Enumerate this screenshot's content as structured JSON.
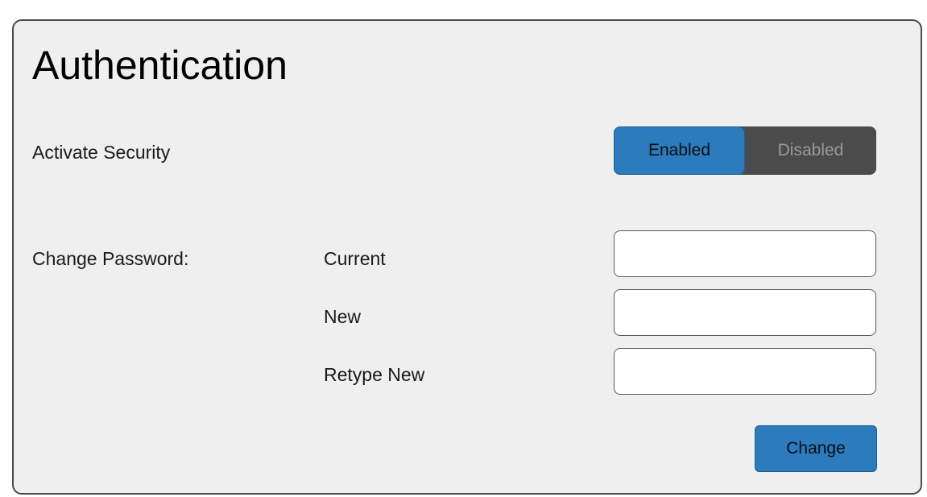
{
  "section": {
    "title": "Authentication"
  },
  "security": {
    "label": "Activate Security",
    "enabled_label": "Enabled",
    "disabled_label": "Disabled",
    "selected": "Enabled",
    "accent_color": "#2b7bbd"
  },
  "password": {
    "label": "Change Password:",
    "current_label": "Current",
    "current_value": "",
    "new_label": "New",
    "new_value": "",
    "retype_label": "Retype New",
    "retype_value": "",
    "change_button": "Change"
  }
}
